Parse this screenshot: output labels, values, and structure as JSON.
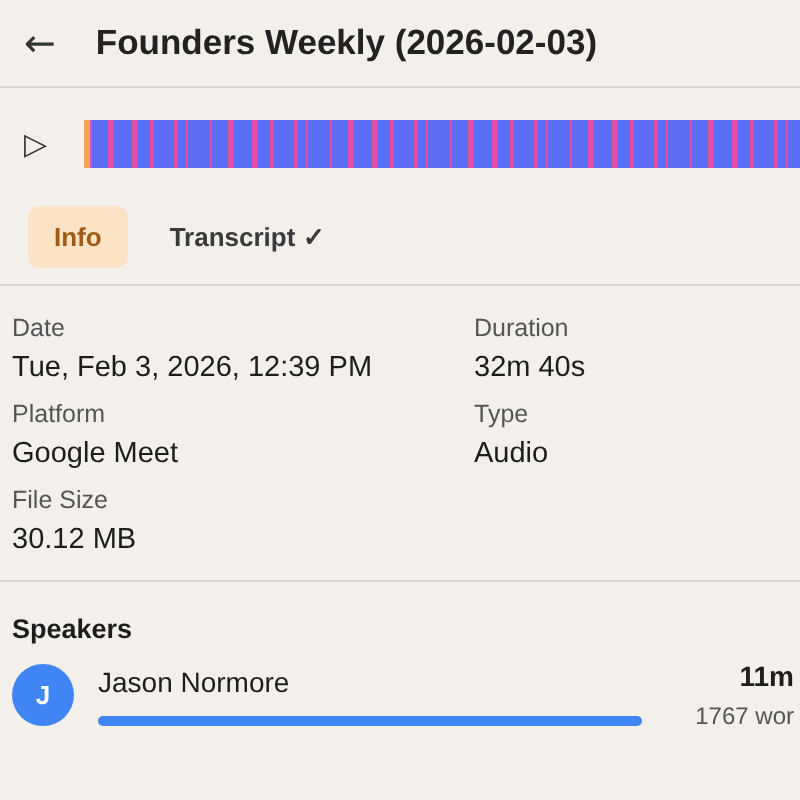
{
  "header": {
    "back": "←",
    "title": "Founders Weekly (2026-02-03)"
  },
  "player": {
    "play": "▷"
  },
  "tabs": [
    {
      "label": "Info",
      "selected": true
    },
    {
      "label": "Transcript ✓",
      "selected": false
    }
  ],
  "info": [
    {
      "label": "Date",
      "value": "Tue, Feb 3, 2026, 12:39 PM"
    },
    {
      "label": "Duration",
      "value": "32m 40s"
    },
    {
      "label": "Platform",
      "value": "Google Meet"
    },
    {
      "label": "Type",
      "value": "Audio"
    },
    {
      "label": "File Size",
      "value": "30.12 MB"
    }
  ],
  "speakers": {
    "title": "Speakers",
    "items": [
      {
        "initial": "J",
        "name": "Jason Normore",
        "color": "#3f86f4",
        "level": 1,
        "time": "11m",
        "words": "1767 wor"
      }
    ]
  }
}
